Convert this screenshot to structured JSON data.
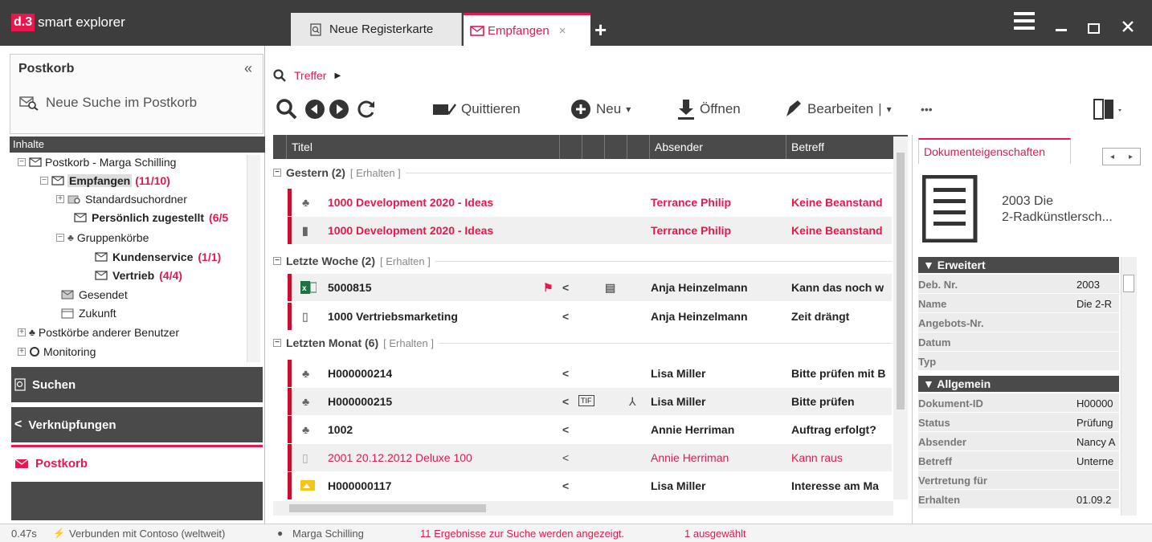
{
  "app": {
    "logo_prefix": "d.3",
    "logo_name": "smart explorer"
  },
  "tabs": [
    {
      "label": "Neue Registerkarte"
    },
    {
      "label": "Empfangen",
      "close": "×"
    }
  ],
  "colors": {
    "accent": "#e8174d",
    "titlebar": "#3d3d3d",
    "panel_header": "#4a4a4a",
    "row_marker": "#c8102e"
  },
  "left": {
    "title": "Postkorb",
    "collapse": "«",
    "new_search": "Neue Suche im Postkorb",
    "inhalte": "Inhalte",
    "tree": [
      {
        "label": "Postkorb - Marga Schilling",
        "count": ""
      },
      {
        "label": "Empfangen",
        "count": "(11/10)"
      },
      {
        "label": "Standardsuchordner",
        "count": ""
      },
      {
        "label": "Persönlich zugestellt",
        "count": "(6/5"
      },
      {
        "label": "Gruppenkörbe",
        "count": ""
      },
      {
        "label": "Kundenservice",
        "count": "(1/1)"
      },
      {
        "label": "Vertrieb",
        "count": "(4/4)"
      },
      {
        "label": "Gesendet",
        "count": ""
      },
      {
        "label": "Zukunft",
        "count": ""
      },
      {
        "label": "Postkörbe anderer Benutzer",
        "count": ""
      },
      {
        "label": "Monitoring",
        "count": ""
      }
    ],
    "nav": [
      {
        "label": "Suchen"
      },
      {
        "label": "Verknüpfungen"
      },
      {
        "label": "Postkorb"
      }
    ]
  },
  "main": {
    "breadcrumb": "Treffer",
    "toolbar": {
      "quittieren": "Quittieren",
      "neu": "Neu",
      "oeffnen": "Öffnen",
      "bearbeiten": "Bearbeiten",
      "more": "•••"
    },
    "columns": [
      "Titel",
      "Absender",
      "Betreff"
    ],
    "groups": [
      {
        "label": "Gestern (2)",
        "action": "[ Erhalten ]"
      },
      {
        "label": "Letzte Woche (2)",
        "action": "[ Erhalten ]"
      },
      {
        "label": "Letzten Monat (6)",
        "action": "[ Erhalten ]"
      }
    ],
    "rows": [
      {
        "title": "1000  Development 2020 - Ideas",
        "sender": "Terrance Philip",
        "subject": "Keine Beanstand"
      },
      {
        "title": "1000  Development 2020 - Ideas",
        "sender": "Terrance Philip",
        "subject": "Keine Beanstand"
      },
      {
        "title": "5000815",
        "sender": "Anja Heinzelmann",
        "subject": "Kann das noch w"
      },
      {
        "title": "1000  Vertriebsmarketing",
        "sender": "Anja Heinzelmann",
        "subject": "Zeit drängt"
      },
      {
        "title": "H000000214",
        "sender": "Lisa Miller",
        "subject": "Bitte prüfen mit B"
      },
      {
        "title": "H000000215",
        "sender": "Lisa Miller",
        "subject": "Bitte prüfen",
        "tag": "TIF"
      },
      {
        "title": "1002",
        "sender": "Annie Herriman",
        "subject": "Auftrag erfolgt?"
      },
      {
        "title": "2001   20.12.2012  Deluxe 100",
        "sender": "Annie Herriman",
        "subject": "Kann raus"
      },
      {
        "title": "H000000117",
        "sender": "Lisa Miller",
        "subject": "Interesse am Ma"
      }
    ]
  },
  "right": {
    "tab": "Dokumenteigenschaften",
    "doc_title_line1": "2003  Die",
    "doc_title_line2": "2-Radkünstlersch...",
    "sections": [
      {
        "title": "Erweitert"
      },
      {
        "title": "Allgemein"
      }
    ],
    "props": [
      {
        "k": "Deb. Nr.",
        "v": "2003"
      },
      {
        "k": "Name",
        "v": "Die 2-R"
      },
      {
        "k": "Angebots-Nr.",
        "v": ""
      },
      {
        "k": "Datum",
        "v": ""
      },
      {
        "k": "Typ",
        "v": ""
      },
      {
        "k": "Dokument-ID",
        "v": "H00000"
      },
      {
        "k": "Status",
        "v": "Prüfung"
      },
      {
        "k": "Absender",
        "v": "Nancy A"
      },
      {
        "k": "Betreff",
        "v": "Unterne"
      },
      {
        "k": "Vertretung für",
        "v": ""
      },
      {
        "k": "Erhalten",
        "v": "01.09.2"
      }
    ]
  },
  "status": {
    "time": "0.47s",
    "connection": "Verbunden mit Contoso (weltweit)",
    "user": "Marga Schilling",
    "results": "11 Ergebnisse zur Suche werden angezeigt.",
    "selected": "1 ausgewählt"
  }
}
